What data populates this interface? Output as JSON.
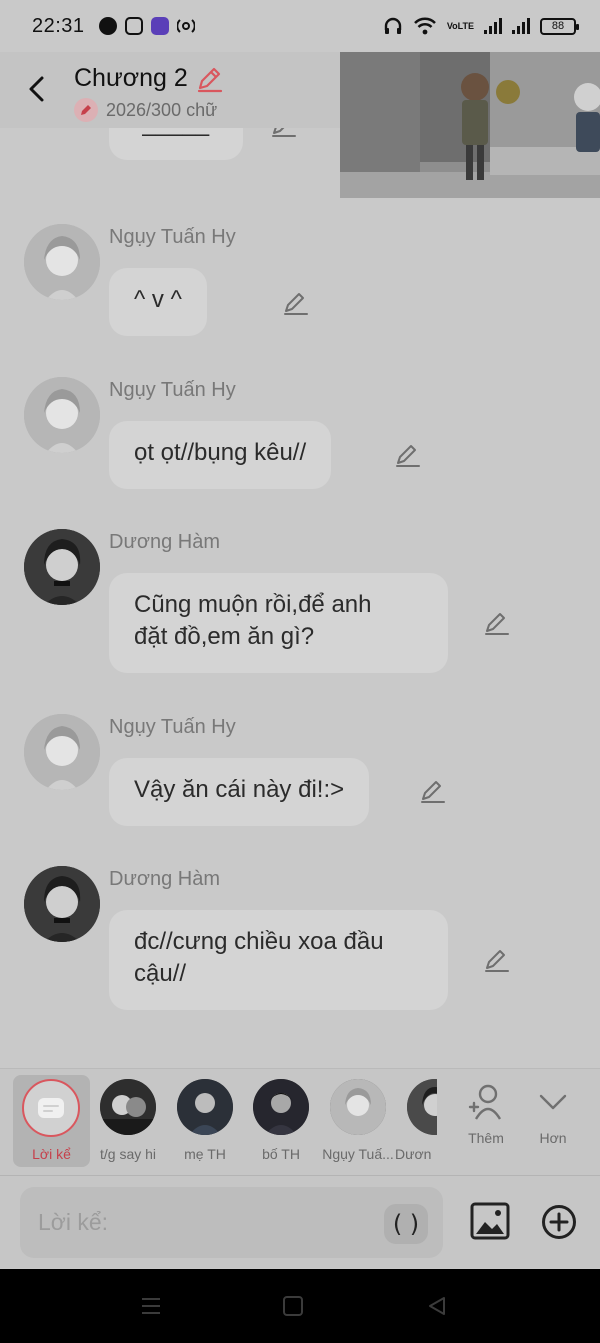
{
  "status_bar": {
    "time": "22:31",
    "app_icons": [
      "facebook-icon",
      "instagram-icon",
      "messenger-app-icon",
      "broadcast-icon"
    ],
    "status_icons": [
      "headphones-icon",
      "wifi-icon",
      "volte-icon",
      "signal-icon",
      "battery-icon"
    ],
    "volte_label": "VoLTE",
    "battery_level": "88"
  },
  "header": {
    "title": "Chương 2",
    "word_count": "2026/300 chữ"
  },
  "messages": [
    {
      "sender": "",
      "text": "•_____•",
      "avatar": "dark"
    },
    {
      "sender": "Ngụy Tuấn Hy",
      "text": "^   v   ^",
      "avatar": "light"
    },
    {
      "sender": "Ngụy Tuấn Hy",
      "text": "ọt ọt//bụng kêu//",
      "avatar": "light"
    },
    {
      "sender": "Dương Hàm",
      "line1": "Cũng muộn rồi,để anh",
      "line2": "đặt đồ,em ăn gì?",
      "avatar": "dark"
    },
    {
      "sender": "Ngụy Tuấn Hy",
      "text": "Vậy ăn cái này đi!:>",
      "avatar": "light"
    },
    {
      "sender": "Dương Hàm",
      "line1": "đc//cưng chiều xoa đầu",
      "line2": "cậu//",
      "avatar": "dark"
    }
  ],
  "character_bar": {
    "narration_label": "Lời kể",
    "characters": [
      {
        "name": "t/g say hi"
      },
      {
        "name": "mẹ TH"
      },
      {
        "name": "bố TH"
      },
      {
        "name": "Ngụy Tuấ..."
      },
      {
        "name": "Dươn"
      }
    ],
    "add_label": "Thêm",
    "more_label": "Hơn"
  },
  "composer": {
    "placeholder": "Lời kể:",
    "paren_label": "( )"
  },
  "colors": {
    "accent": "#d9575e",
    "overlay_bg": "#c9c9c9"
  }
}
